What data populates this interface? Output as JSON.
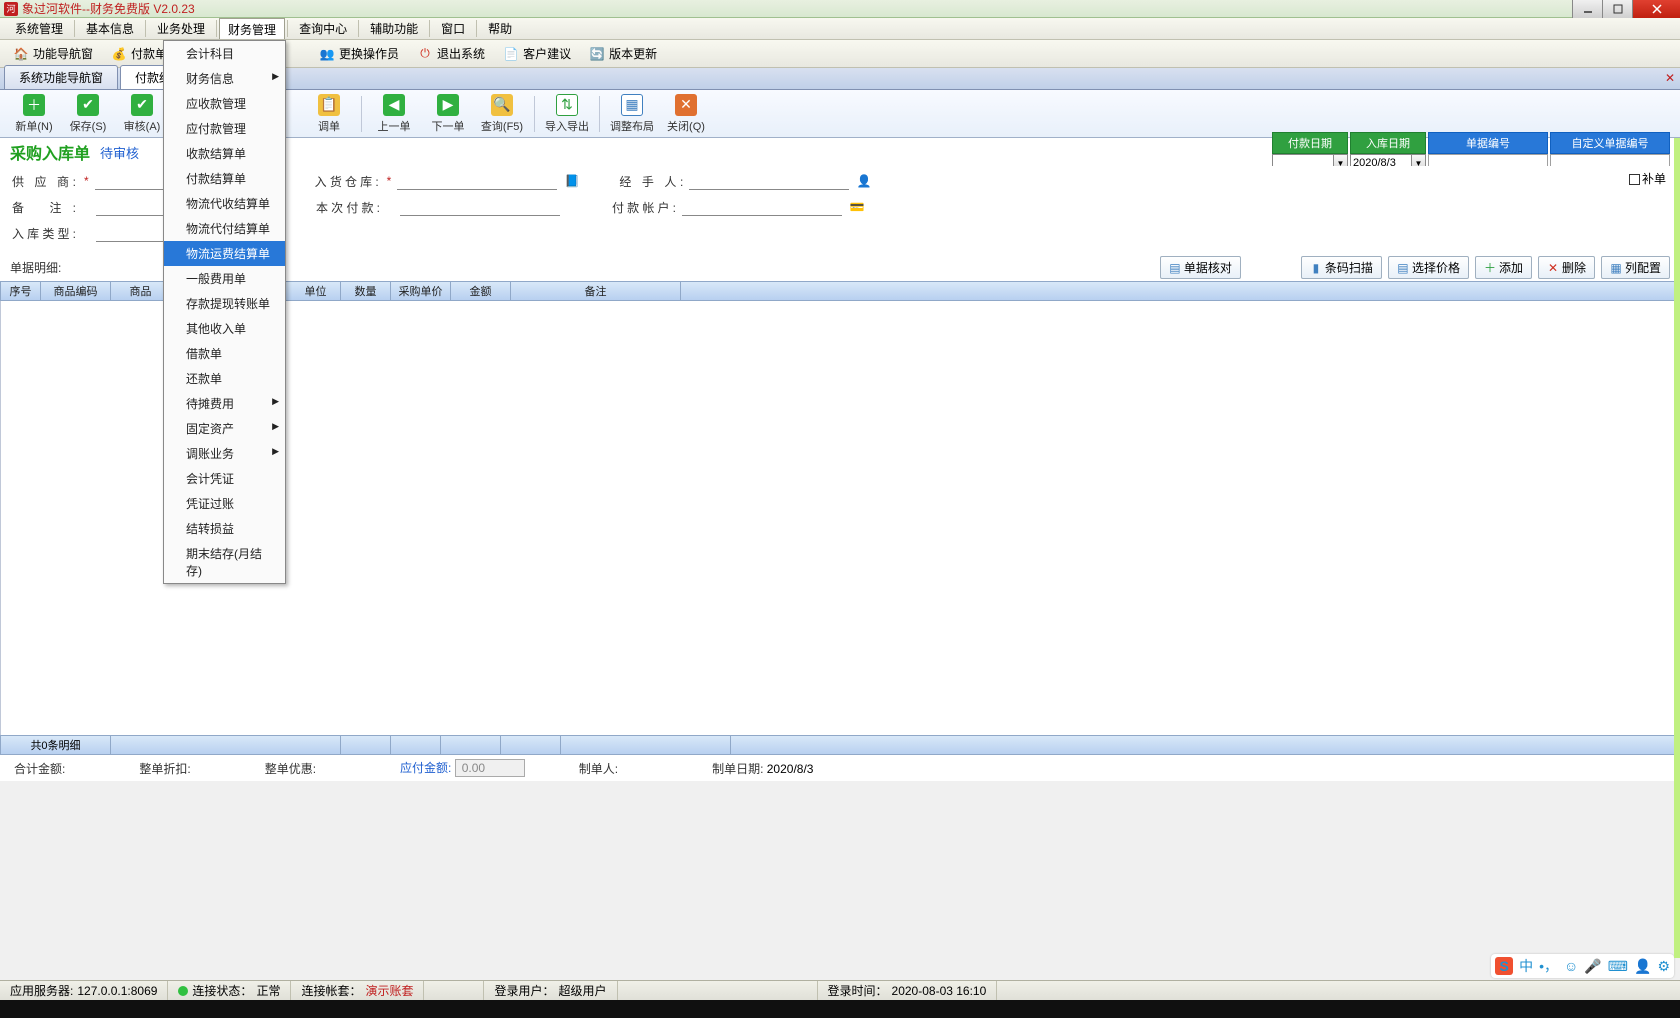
{
  "window": {
    "title": "象过河软件--财务免费版 V2.0.23"
  },
  "menu": {
    "items": [
      "系统管理",
      "基本信息",
      "业务处理",
      "财务管理",
      "查询中心",
      "辅助功能",
      "窗口",
      "帮助"
    ],
    "active_index": 3
  },
  "main_toolbar": {
    "b1": "功能导航窗",
    "b2": "付款单",
    "b3": "更换操作员",
    "b4": "退出系统",
    "b5": "客户建议",
    "b6": "版本更新"
  },
  "tabs": {
    "items": [
      "系统功能导航窗",
      "付款结算单"
    ],
    "active_index": 1
  },
  "doc_toolbar": {
    "new": "新单(N)",
    "save": "保存(S)",
    "audit": "审核(A)",
    "adjust": "调单",
    "prev": "上一单",
    "next": "下一单",
    "query": "查询(F5)",
    "io": "导入导出",
    "layout": "调整布局",
    "close": "关闭(Q)"
  },
  "doc": {
    "title": "采购入库单",
    "status": "待审核",
    "header_labels": {
      "pay_date": "付款日期",
      "in_date": "入库日期",
      "bill_no": "单据编号",
      "custom_no": "自定义单据编号"
    },
    "in_date": "2020/8/3",
    "budan": "补单"
  },
  "form": {
    "labels": {
      "supplier": "供 应 商:",
      "warehouse": "入货仓库:",
      "handler": "经 手 人:",
      "remark": "备    注:",
      "thispay": "本次付款:",
      "payacct": "付款帐户:",
      "intype": "入库类型:",
      "detail": "单据明细:"
    }
  },
  "detail_buttons": {
    "check": "单据核对",
    "scan": "条码扫描",
    "price": "选择价格",
    "add": "添加",
    "del": "删除",
    "col": "列配置"
  },
  "table": {
    "columns": [
      "序号",
      "商品编码",
      "商品",
      "单位",
      "数量",
      "采购单价",
      "金额",
      "备注"
    ],
    "summary": "共0条明细"
  },
  "totals": {
    "total": "合计金额:",
    "discount": "整单折扣:",
    "pref": "整单优惠:",
    "payable": "应付金额:",
    "payable_val": "0.00",
    "maker": "制单人:",
    "makedate": "制单日期:",
    "makedate_val": "2020/8/3"
  },
  "dropdown": {
    "items": [
      {
        "label": "会计科目"
      },
      {
        "label": "财务信息",
        "sub": true
      },
      {
        "label": "应收款管理"
      },
      {
        "label": "应付款管理"
      },
      {
        "label": "收款结算单"
      },
      {
        "label": "付款结算单"
      },
      {
        "label": "物流代收结算单"
      },
      {
        "label": "物流代付结算单"
      },
      {
        "label": "物流运费结算单",
        "hover": true
      },
      {
        "label": "一般费用单"
      },
      {
        "label": "存款提现转账单"
      },
      {
        "label": "其他收入单"
      },
      {
        "label": "借款单"
      },
      {
        "label": "还款单"
      },
      {
        "label": "待摊费用",
        "sub": true
      },
      {
        "label": "固定资产",
        "sub": true
      },
      {
        "label": "调账业务",
        "sub": true
      },
      {
        "label": "会计凭证"
      },
      {
        "label": "凭证过账"
      },
      {
        "label": "结转损益"
      },
      {
        "label": "期末结存(月结存)"
      }
    ]
  },
  "status": {
    "server_l": "应用服务器:",
    "server": "127.0.0.1:8069",
    "conn_l": "连接状态：",
    "conn": "正常",
    "acct_l": "连接帐套：",
    "acct": "演示账套",
    "user_l": "登录用户：",
    "user": "超级用户",
    "time_l": "登录时间：",
    "time": "2020-08-03 16:10"
  },
  "ime": {
    "s": "S",
    "cn": "中"
  }
}
